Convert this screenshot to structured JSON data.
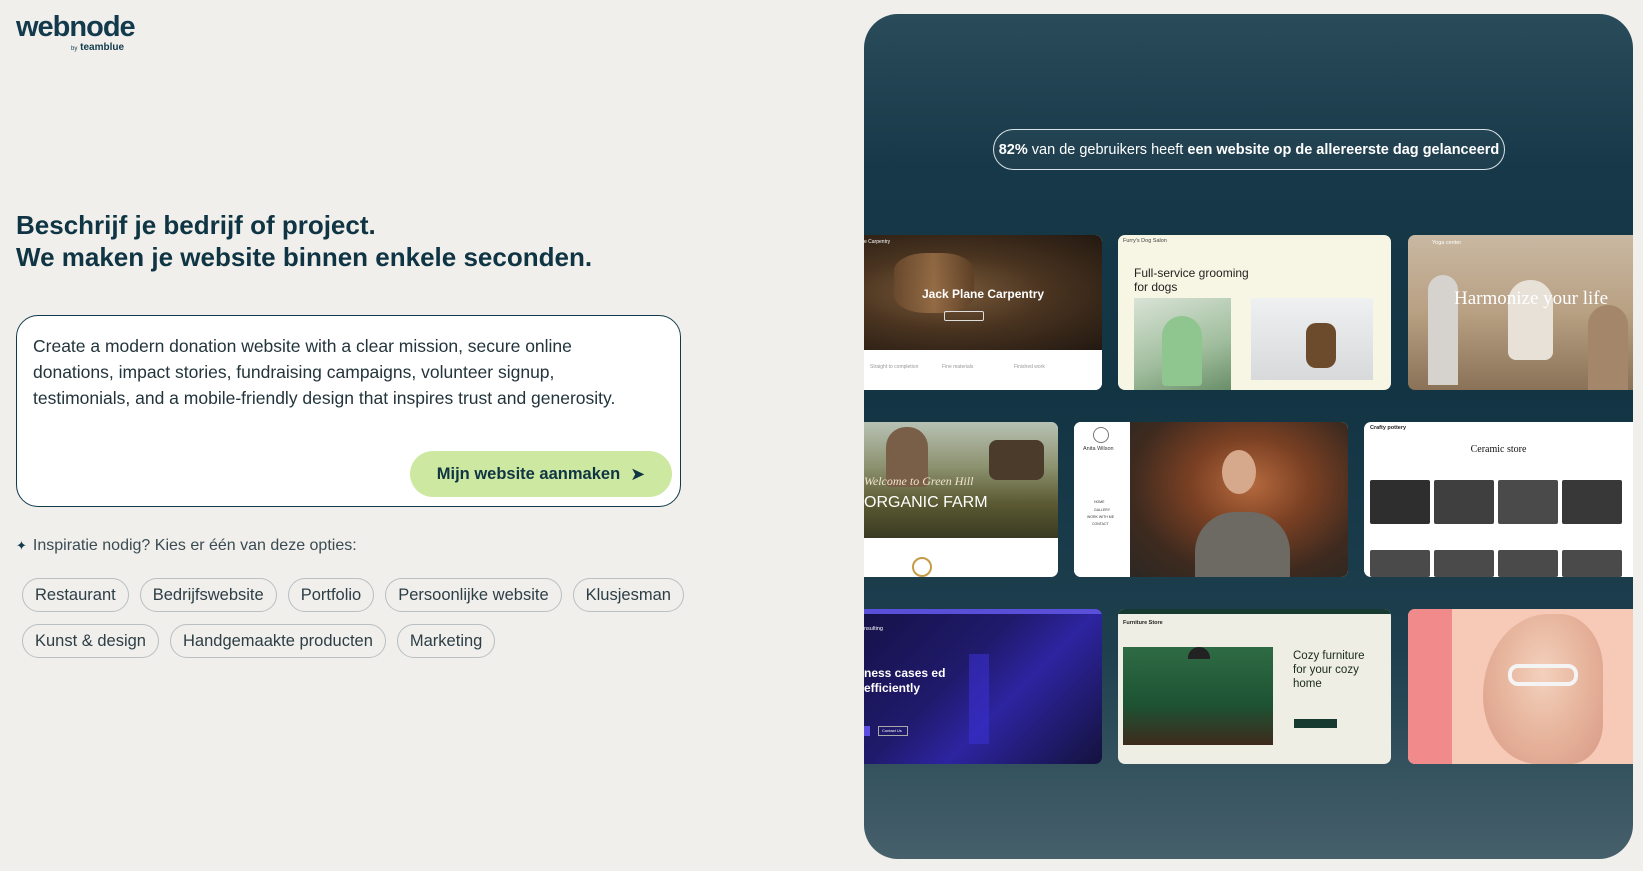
{
  "logo": {
    "name": "webnode",
    "by": "by",
    "brand": "teamblue"
  },
  "headline": {
    "line1": "Beschrijf je bedrijf of project.",
    "line2": "We maken je website binnen enkele seconden."
  },
  "prompt": {
    "text": "Create a modern donation website with a clear mission, secure online donations, impact stories, fundraising campaigns, volunteer signup, testimonials, and a mobile-friendly design that inspires trust and generosity.",
    "button_label": "Mijn website aanmaken",
    "button_icon": "arrow-right-icon"
  },
  "inspiration": {
    "label": "Inspiratie nodig? Kies er één van deze opties:",
    "icon": "sparkle-icon",
    "options": [
      "Restaurant",
      "Bedrijfswebsite",
      "Portfolio",
      "Persoonlijke website",
      "Klusjesman",
      "Kunst & design",
      "Handgemaakte producten",
      "Marketing"
    ]
  },
  "showcase": {
    "stat_prefix": "82%",
    "stat_middle": " van de gebruikers heeft ",
    "stat_bold": "een website op de allereerste dag gelanceerd",
    "templates": {
      "carpentry": {
        "nav": "e Carpentry",
        "title": "Jack Plane Carpentry",
        "feat1": "Straight to completion",
        "feat2": "Fine materials",
        "feat3": "Finished work"
      },
      "dog_salon": {
        "brand": "Furry's Dog Salon",
        "title": "Full-service grooming for dogs"
      },
      "yoga": {
        "brand": "Yoga center",
        "title": "Harmonize your life"
      },
      "farm": {
        "script": "Welcome to Green Hill",
        "title": "ORGANIC FARM"
      },
      "portfolio": {
        "name": "Anita Wilson",
        "menu": [
          "HOME",
          "GALLERY",
          "WORK WITH ME",
          "CONTACT"
        ]
      },
      "ceramic": {
        "brand": "Crafty pottery",
        "title": "Ceramic store"
      },
      "consulting": {
        "brand": "nsulting",
        "title": "ness cases ed efficiently",
        "button": "Contact Us"
      },
      "furniture": {
        "brand": "Furniture Store",
        "title": "Cozy furniture for your cozy home"
      },
      "optics": {
        "name": ""
      }
    }
  }
}
